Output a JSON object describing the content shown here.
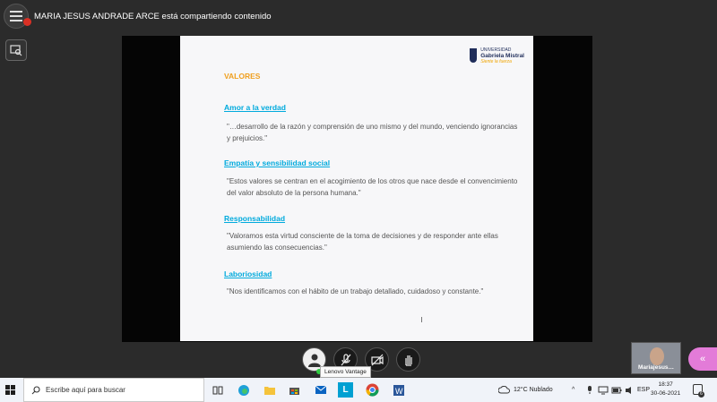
{
  "meeting": {
    "share_notice": "MARIA JESUS ANDRADE ARCE está compartiendo contenido"
  },
  "slide": {
    "logo": {
      "line1": "UNIVERSIDAD",
      "line2": "Gabriela Mistral",
      "tagline": "Siente la fuerza"
    },
    "title": "VALORES",
    "values": [
      {
        "heading": "Amor a la verdad",
        "text": "\"…desarrollo de la razón y comprensión de uno mismo y del mundo, venciendo ignorancias y prejuicios.\""
      },
      {
        "heading": "Empatía y sensibilidad social",
        "text": "\"Estos valores se centran en el acogimiento de los otros que nace desde el convencimiento del valor absoluto de la persona humana.\""
      },
      {
        "heading": "Responsabilidad",
        "text": "\"Valoramos esta virtud consciente de la toma de decisiones y de responder ante ellas asumiendo las consecuencias.\""
      },
      {
        "heading": "Laboriosidad",
        "text": "\"Nos identificamos con el hábito de un trabajo detallado, cuidadoso y constante.\""
      }
    ]
  },
  "controls": {
    "tooltip": "Lenovo Vantage"
  },
  "participant": {
    "name": "Mariajesus…"
  },
  "taskbar": {
    "search_placeholder": "Escribe aquí para buscar",
    "weather": "12°C Nublado",
    "language": "ESP",
    "time": "18:37",
    "date": "30-06-2021",
    "notification_count": "6"
  },
  "colors": {
    "accent_orange": "#f0a020",
    "heading_blue": "#00aadd",
    "pill_pink": "#e37bd8"
  }
}
